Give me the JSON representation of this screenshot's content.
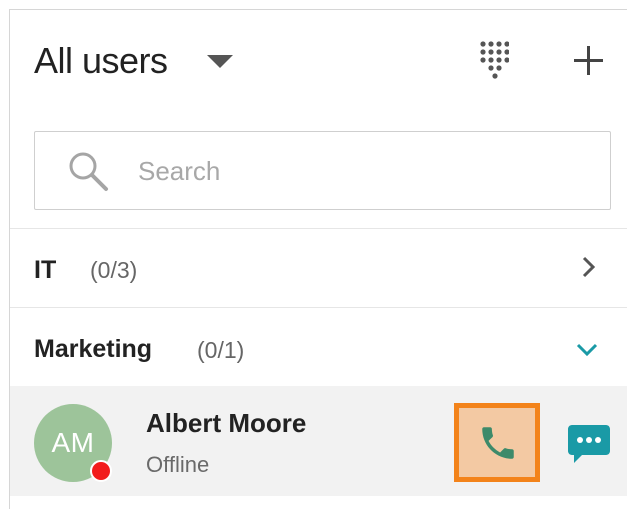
{
  "header": {
    "title": "All users",
    "dialpad_icon": "dialpad-icon",
    "add_icon": "plus-icon"
  },
  "search": {
    "placeholder": "Search",
    "value": "",
    "icon": "search-icon"
  },
  "groups": [
    {
      "name": "IT",
      "count": "(0/3)",
      "expanded": false,
      "chevron_icon": "chevron-right-icon"
    },
    {
      "name": "Marketing",
      "count": "(0/1)",
      "expanded": true,
      "chevron_icon": "chevron-down-icon"
    }
  ],
  "users": [
    {
      "initials": "AM",
      "name": "Albert Moore",
      "status": "Offline",
      "status_color": "#f21c1c",
      "avatar_color": "#9dc49a",
      "call_icon": "phone-icon",
      "chat_icon": "chat-icon"
    }
  ],
  "colors": {
    "accent": "#1a9aa6",
    "call_highlight_border": "#f3831a",
    "call_highlight_fill": "#f3c9a3",
    "phone_icon": "#3d8a6a"
  }
}
